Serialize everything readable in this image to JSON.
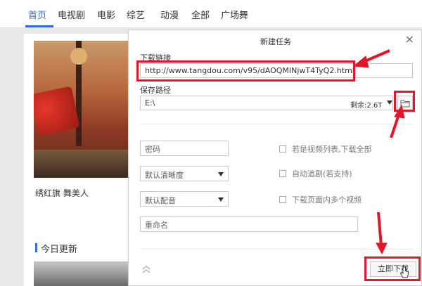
{
  "nav": {
    "items": [
      "首页",
      "电视剧",
      "电影",
      "综艺",
      "动漫",
      "全部",
      "广场舞"
    ],
    "active": 0
  },
  "left": {
    "poster_caption": "绣红旗 舞美人",
    "section_title": "今日更新"
  },
  "dialog": {
    "title": "新建任务",
    "close": "×",
    "url_label": "下载链接",
    "url_value": "http://www.tangdou.com/v95/dAOQMINjwT4TyQ2.html",
    "path_label": "保存路径",
    "path_value": "E:\\",
    "free_space": "剩余:2.6T",
    "password_placeholder": "密码",
    "quality_select": "默认清晰度",
    "audio_select": "默认配音",
    "rename_placeholder": "重命名",
    "checkbox_all": "若是视频列表,下载全部",
    "checkbox_sub": "自动追剧(若支持)",
    "checkbox_multi": "下载页面内多个视频",
    "download_button": "立即下载"
  },
  "colors": {
    "accent": "#2f6fd6",
    "annotation_red": "#e0182a"
  }
}
